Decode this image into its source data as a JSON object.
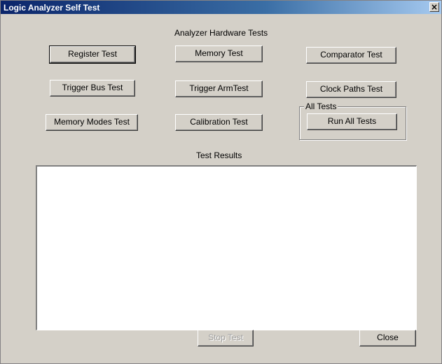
{
  "window": {
    "title": "Logic Analyzer Self Test",
    "close_glyph": "×"
  },
  "hardware_tests": {
    "heading": "Analyzer Hardware Tests",
    "buttons": {
      "register": "Register Test",
      "memory": "Memory Test",
      "comparator": "Comparator Test",
      "trigger_bus": "Trigger Bus Test",
      "trigger_arm": "Trigger ArmTest",
      "clock_paths": "Clock Paths Test",
      "memory_modes": "Memory Modes Test",
      "calibration": "Calibration Test"
    }
  },
  "all_tests": {
    "group_label": "All Tests",
    "run_all": "Run All Tests"
  },
  "results": {
    "heading": "Test Results",
    "content": ""
  },
  "footer": {
    "stop_test": "Stop Test",
    "close": "Close"
  },
  "colors": {
    "dialog_face": "#d4d0c8",
    "title_start": "#0a246a",
    "title_end": "#a6caf0",
    "disabled_text": "#a0a0a0"
  }
}
